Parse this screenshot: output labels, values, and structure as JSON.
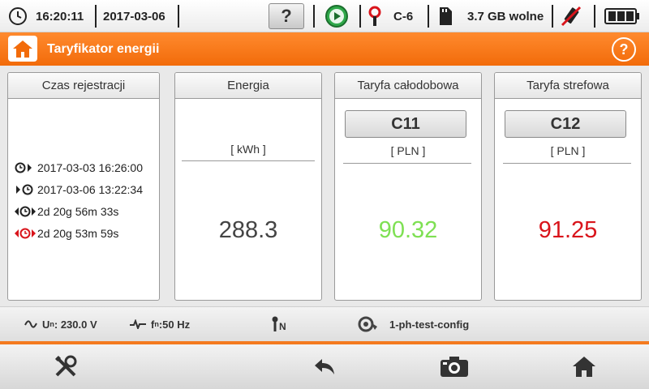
{
  "status": {
    "time": "16:20:11",
    "date": "2017-03-06",
    "help_label": "?",
    "clamp_label": "C-6",
    "storage_label": "3.7 GB wolne"
  },
  "header": {
    "title": "Taryfikator energii",
    "help_label": "?"
  },
  "panels": {
    "time": {
      "title": "Czas rejestracji",
      "start": "2017-03-03 16:26:00",
      "end": "2017-03-06 13:22:34",
      "duration": "2d 20g 56m 33s",
      "active": "2d 20g 53m 59s"
    },
    "energy": {
      "title": "Energia",
      "unit": "[ kWh ]",
      "value": "288.3"
    },
    "tariff_flat": {
      "title": "Taryfa całodobowa",
      "code": "C11",
      "unit": "[ PLN ]",
      "value": "90.32"
    },
    "tariff_zone": {
      "title": "Taryfa strefowa",
      "code": "C12",
      "unit": "[ PLN ]",
      "value": "91.25"
    }
  },
  "infobar": {
    "voltage_symbol": "U",
    "voltage_sub": "n",
    "voltage_value": ": 230.0 V",
    "freq_symbol": "f",
    "freq_sub": "n",
    "freq_value": ":50 Hz",
    "neutral_label": "N",
    "config_name": "1-ph-test-config"
  },
  "colors": {
    "accent": "#f47a1f",
    "flat_value": "#7ee053",
    "zone_value": "#d9141b",
    "energy_value": "#444444"
  },
  "icons": [
    "clock-icon",
    "help-icon",
    "play-icon",
    "clamp-icon",
    "sd-card-icon",
    "usb-disconnected-icon",
    "battery-icon",
    "home-icon",
    "tools-icon",
    "back-icon",
    "camera-icon"
  ]
}
